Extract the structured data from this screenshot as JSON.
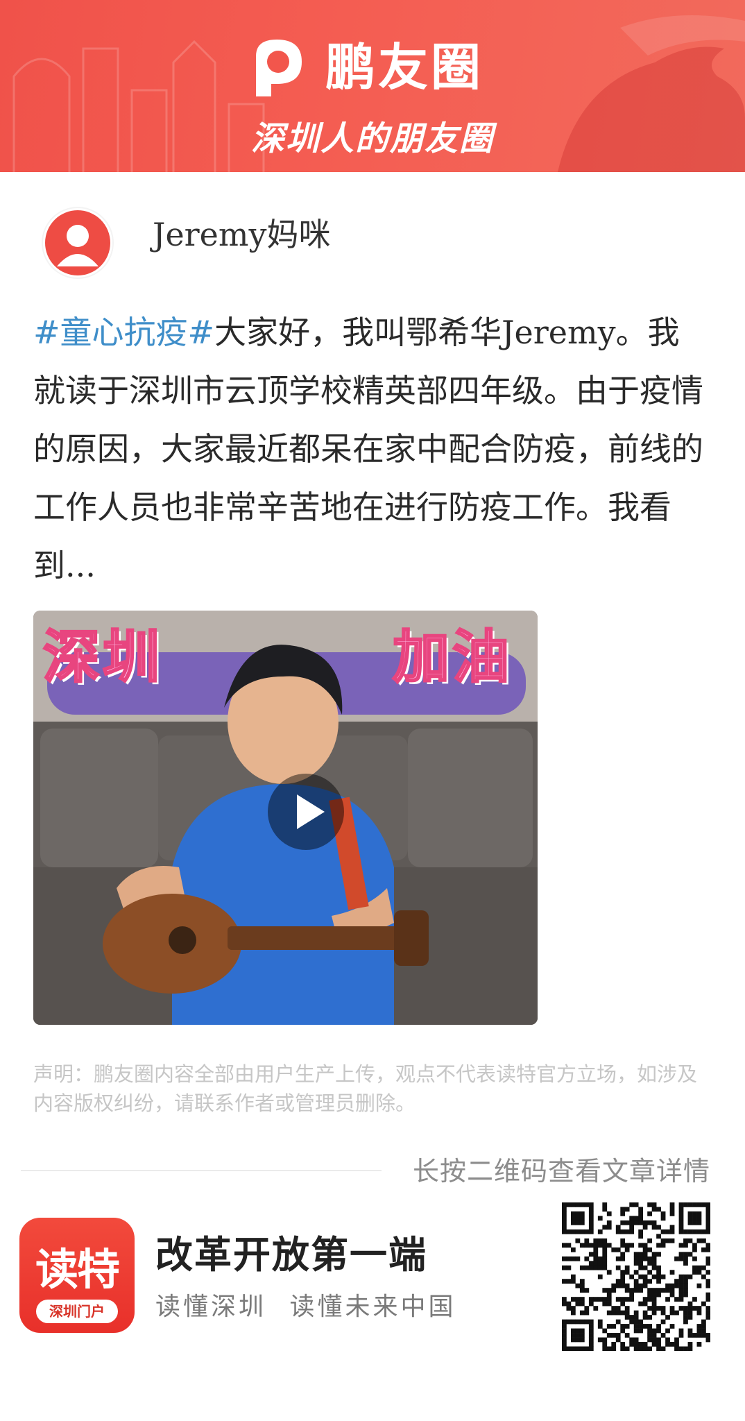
{
  "banner": {
    "brand_name": "鹏友圈",
    "slogan": "深圳人的朋友圈",
    "background_color": "#f2564c"
  },
  "post": {
    "author": "Jeremy妈咪",
    "avatar_icon": "user-avatar-icon",
    "hashtag": "#童心抗疫#",
    "body": "大家好，我叫鄂希华Jeremy。我就读于深圳市云顶学校精英部四年级。由于疫情的原因，大家最近都呆在家中配合防疫，前线的工作人员也非常辛苦地在进行防疫工作。我看到...",
    "hashtag_color": "#3f8ec9"
  },
  "video": {
    "overlay_left": "深圳",
    "overlay_right": "加油",
    "play_icon": "play-icon"
  },
  "disclaimer": "声明：鹏友圈内容全部由用户生产上传，观点不代表读特官方立场，如涉及内容版权纠纷，请联系作者或管理员删除。",
  "qr_hint": "长按二维码查看文章详情",
  "footer": {
    "app_icon_text": "读特",
    "app_icon_subtext": "深圳门户",
    "title": "改革开放第一端",
    "slogan": "读懂深圳 读懂未来中国",
    "accent_color": "#e8302a"
  }
}
